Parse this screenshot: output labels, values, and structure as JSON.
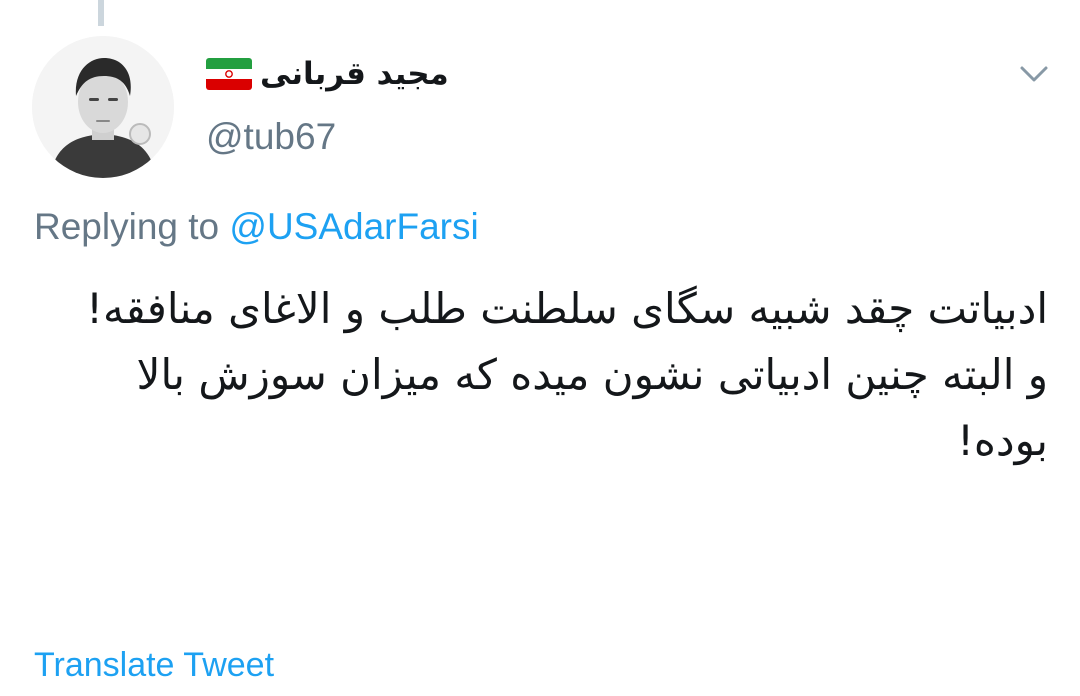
{
  "tweet": {
    "author": {
      "display_name": "مجید قربانی",
      "flag_icon": "iran-flag-icon",
      "handle": "@tub67"
    },
    "menu_icon": "chevron-down-icon",
    "replying_prefix": "Replying to",
    "replying_to": "@USAdarFarsi",
    "text_paragraph_1": "ادبیاتت چقد شبیه سگای سلطنت طلب و الاغای منافقه!",
    "text_paragraph_2": "و البته چنین ادبیاتی نشون میده که میزان سوزش بالا بوده!",
    "translate_label": "Translate Tweet"
  },
  "colors": {
    "text_primary": "#14171a",
    "text_secondary": "#657786",
    "link": "#1da1f2",
    "thread_line": "#ccd6dd",
    "flag_green": "#239f40",
    "flag_white": "#ffffff",
    "flag_red": "#da0000"
  }
}
